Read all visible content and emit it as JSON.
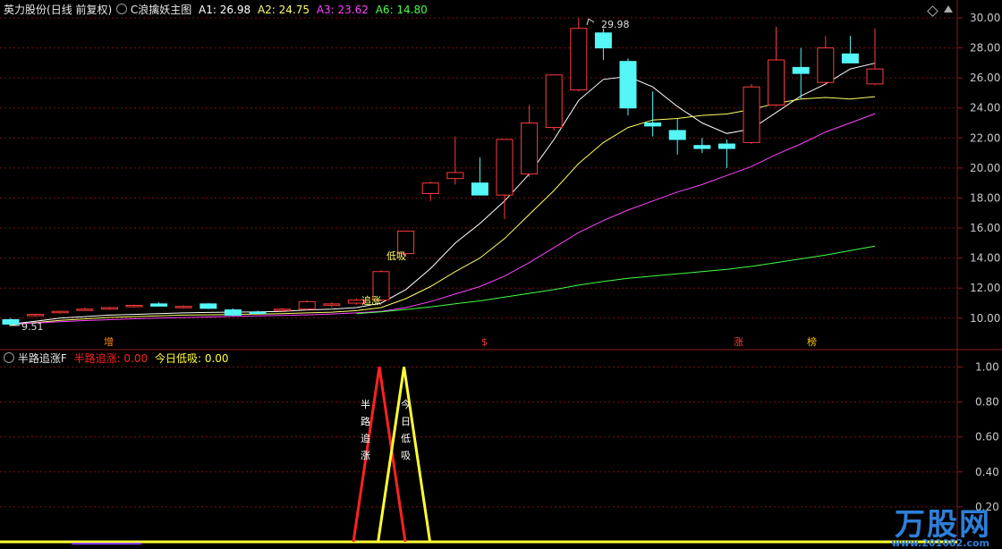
{
  "header": {
    "stock_name": "英力股份",
    "period": "(日线 前复权)",
    "indicator_name": "C浪擒妖主图",
    "a1_label": "A1: 26.98",
    "a2_label": "A2: 24.75",
    "a3_label": "A3: 23.62",
    "a6_label": "A6: 14.80",
    "colors": {
      "a1": "#ffffff",
      "a2": "#ffff66",
      "a3": "#ff44ff",
      "a6": "#44ff44"
    }
  },
  "sub_header": {
    "indicator_name": "半路追涨F",
    "line1_label": "半路追涨: 0.00",
    "line2_label": "今日低吸: 0.00",
    "colors": {
      "line1": "#ff2222",
      "line2": "#ffff33"
    }
  },
  "markers": {
    "zeng": "增",
    "dollar": "$",
    "zhang": "涨",
    "bang": "榜",
    "low_label": "9.51",
    "high_label": "29.98",
    "dixi": "低吸",
    "zhuizhang": "追涨",
    "sub_text1": "半路追涨",
    "sub_text2": "今日低吸"
  },
  "watermark": {
    "brand": "万股网",
    "url": "www.201082.com"
  },
  "chart_data": [
    {
      "type": "candlestick",
      "title": "C浪擒妖主图",
      "ylim": [
        8.8,
        30.6
      ],
      "y_ticks": [
        "10.00",
        "12.00",
        "14.00",
        "16.00",
        "18.00",
        "20.00",
        "22.00",
        "24.00",
        "26.00",
        "28.00",
        "30.00"
      ],
      "candles": [
        {
          "o": 9.9,
          "h": 10.0,
          "l": 9.51,
          "c": 9.6
        },
        {
          "o": 10.2,
          "h": 10.3,
          "l": 10.1,
          "c": 10.25
        },
        {
          "o": 10.4,
          "h": 10.5,
          "l": 10.3,
          "c": 10.45
        },
        {
          "o": 10.55,
          "h": 10.7,
          "l": 10.5,
          "c": 10.6
        },
        {
          "o": 10.6,
          "h": 10.75,
          "l": 10.55,
          "c": 10.7
        },
        {
          "o": 10.8,
          "h": 10.9,
          "l": 10.7,
          "c": 10.85
        },
        {
          "o": 10.95,
          "h": 11.05,
          "l": 10.8,
          "c": 10.8
        },
        {
          "o": 10.75,
          "h": 10.85,
          "l": 10.65,
          "c": 10.78
        },
        {
          "o": 10.95,
          "h": 11.0,
          "l": 10.6,
          "c": 10.65
        },
        {
          "o": 10.55,
          "h": 10.65,
          "l": 10.15,
          "c": 10.2
        },
        {
          "o": 10.4,
          "h": 10.5,
          "l": 10.3,
          "c": 10.35
        },
        {
          "o": 10.55,
          "h": 10.65,
          "l": 10.45,
          "c": 10.6
        },
        {
          "o": 10.6,
          "h": 11.2,
          "l": 10.5,
          "c": 11.1
        },
        {
          "o": 10.9,
          "h": 11.05,
          "l": 10.7,
          "c": 10.95
        },
        {
          "o": 11.0,
          "h": 11.3,
          "l": 10.9,
          "c": 11.2
        },
        {
          "o": 11.2,
          "h": 13.2,
          "l": 11.1,
          "c": 13.1
        },
        {
          "o": 14.3,
          "h": 15.8,
          "l": 14.1,
          "c": 15.8
        },
        {
          "o": 18.3,
          "h": 19.1,
          "l": 17.8,
          "c": 19.0
        },
        {
          "o": 19.3,
          "h": 22.1,
          "l": 18.9,
          "c": 19.7
        },
        {
          "o": 19.0,
          "h": 20.7,
          "l": 18.3,
          "c": 18.2
        },
        {
          "o": 18.2,
          "h": 21.9,
          "l": 16.6,
          "c": 21.9
        },
        {
          "o": 19.6,
          "h": 24.2,
          "l": 19.4,
          "c": 23.0
        },
        {
          "o": 22.7,
          "h": 26.2,
          "l": 22.5,
          "c": 26.2
        },
        {
          "o": 25.2,
          "h": 29.98,
          "l": 25.1,
          "c": 29.3
        },
        {
          "o": 29.0,
          "h": 29.3,
          "l": 27.2,
          "c": 28.0
        },
        {
          "o": 27.1,
          "h": 27.3,
          "l": 23.5,
          "c": 24.0
        },
        {
          "o": 23.0,
          "h": 25.1,
          "l": 22.1,
          "c": 22.8
        },
        {
          "o": 22.5,
          "h": 23.3,
          "l": 20.9,
          "c": 21.9
        },
        {
          "o": 21.5,
          "h": 22.0,
          "l": 21.0,
          "c": 21.3
        },
        {
          "o": 21.6,
          "h": 21.9,
          "l": 20.0,
          "c": 21.3
        },
        {
          "o": 21.7,
          "h": 25.6,
          "l": 21.6,
          "c": 25.4
        },
        {
          "o": 24.2,
          "h": 29.4,
          "l": 24.1,
          "c": 27.2
        },
        {
          "o": 26.7,
          "h": 28.0,
          "l": 24.6,
          "c": 26.3
        },
        {
          "o": 25.7,
          "h": 28.8,
          "l": 25.5,
          "c": 28.0
        },
        {
          "o": 27.6,
          "h": 28.8,
          "l": 27.0,
          "c": 27.0
        },
        {
          "o": 25.6,
          "h": 29.3,
          "l": 25.5,
          "c": 26.6
        }
      ],
      "series": [
        {
          "name": "A1",
          "color": "#ffffff",
          "values": [
            9.6,
            9.8,
            10.0,
            10.1,
            10.2,
            10.25,
            10.3,
            10.35,
            10.38,
            10.4,
            10.42,
            10.45,
            10.55,
            10.6,
            10.7,
            11.0,
            11.9,
            13.3,
            15.0,
            16.3,
            17.8,
            19.6,
            21.9,
            24.5,
            25.9,
            26.1,
            25.4,
            24.1,
            23.0,
            22.3,
            22.6,
            23.7,
            24.8,
            25.6,
            26.6,
            26.98
          ]
        },
        {
          "name": "A2",
          "color": "#ffff66",
          "values": [
            9.55,
            9.7,
            9.85,
            9.95,
            10.05,
            10.1,
            10.15,
            10.2,
            10.22,
            10.25,
            10.27,
            10.3,
            10.35,
            10.4,
            10.5,
            10.7,
            11.3,
            12.1,
            13.1,
            14.0,
            15.3,
            16.9,
            18.5,
            20.3,
            21.7,
            22.7,
            23.2,
            23.3,
            23.5,
            23.6,
            23.9,
            24.3,
            24.6,
            24.7,
            24.6,
            24.75
          ]
        },
        {
          "name": "A3",
          "color": "#ff44ff",
          "values": [
            9.6,
            9.68,
            9.76,
            9.84,
            9.9,
            9.96,
            10.0,
            10.04,
            10.08,
            10.12,
            10.15,
            10.18,
            10.22,
            10.28,
            10.35,
            10.45,
            10.7,
            11.1,
            11.6,
            12.1,
            12.8,
            13.7,
            14.7,
            15.7,
            16.5,
            17.2,
            17.8,
            18.4,
            18.9,
            19.5,
            20.1,
            20.9,
            21.6,
            22.4,
            23.0,
            23.62
          ]
        },
        {
          "name": "A6",
          "color": "#44ff44",
          "values": [
            null,
            null,
            null,
            null,
            null,
            null,
            null,
            null,
            null,
            null,
            null,
            null,
            null,
            null,
            10.3,
            10.42,
            10.58,
            10.75,
            10.95,
            11.15,
            11.4,
            11.65,
            11.9,
            12.2,
            12.45,
            12.65,
            12.8,
            12.95,
            13.1,
            13.25,
            13.45,
            13.7,
            13.95,
            14.2,
            14.5,
            14.8
          ]
        }
      ]
    },
    {
      "type": "line",
      "title": "半路追涨F",
      "ylim": [
        0,
        1.05
      ],
      "y_ticks": [
        "0.20",
        "0.40",
        "0.60",
        "0.80",
        "1.00"
      ],
      "series": [
        {
          "name": "半路追涨",
          "color": "#ff2222",
          "values": [
            0,
            0,
            0,
            0,
            0,
            0,
            0,
            0,
            0,
            0,
            0,
            0,
            0,
            0,
            0,
            1,
            0,
            0,
            0,
            0,
            0,
            0,
            0,
            0,
            0,
            0,
            0,
            0,
            0,
            0,
            0,
            0,
            0,
            0,
            0,
            0
          ]
        },
        {
          "name": "今日低吸",
          "color": "#ffff33",
          "values": [
            0,
            0,
            0,
            0,
            0,
            0,
            0,
            0,
            0,
            0,
            0,
            0,
            0,
            0,
            0,
            0,
            1,
            0,
            0,
            0,
            0,
            0,
            0,
            0,
            0,
            0,
            0,
            0,
            0,
            0,
            0,
            0,
            0,
            0,
            0,
            0
          ]
        }
      ]
    }
  ]
}
